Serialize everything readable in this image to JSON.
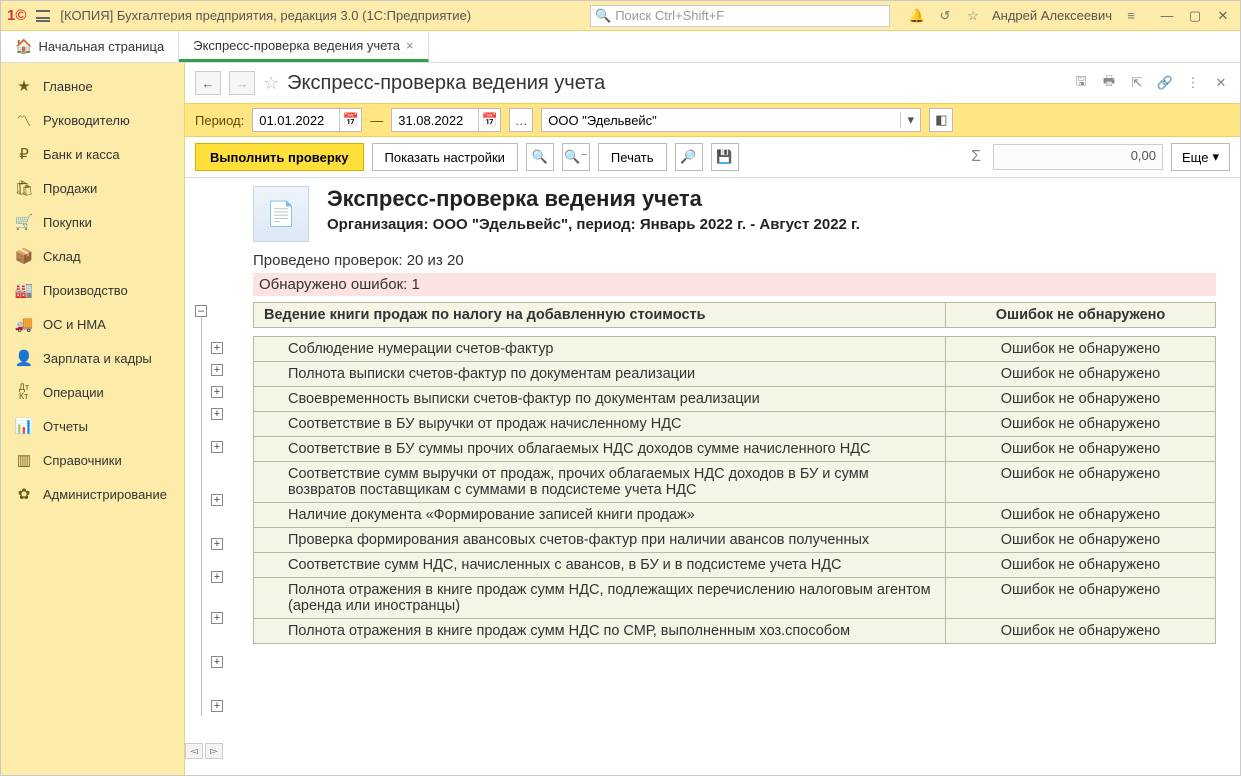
{
  "titlebar": {
    "app_title": "[КОПИЯ] Бухгалтерия предприятия, редакция 3.0  (1С:Предприятие)",
    "search_placeholder": "Поиск Ctrl+Shift+F",
    "user": "Андрей Алексеевич"
  },
  "tabs": {
    "home": "Начальная страница",
    "active": "Экспресс-проверка ведения учета"
  },
  "sidebar": {
    "items": [
      {
        "icon": "★",
        "label": "Главное"
      },
      {
        "icon": "📈",
        "label": "Руководителю"
      },
      {
        "icon": "₽",
        "label": "Банк и касса"
      },
      {
        "icon": "🛍",
        "label": "Продажи"
      },
      {
        "icon": "🛒",
        "label": "Покупки"
      },
      {
        "icon": "📦",
        "label": "Склад"
      },
      {
        "icon": "🏭",
        "label": "Производство"
      },
      {
        "icon": "🚚",
        "label": "ОС и НМА"
      },
      {
        "icon": "👤",
        "label": "Зарплата и кадры"
      },
      {
        "icon": "Дт",
        "label": "Операции"
      },
      {
        "icon": "📊",
        "label": "Отчеты"
      },
      {
        "icon": "📚",
        "label": "Справочники"
      },
      {
        "icon": "✿",
        "label": "Администрирование"
      }
    ]
  },
  "page": {
    "title": "Экспресс-проверка ведения учета",
    "period_label": "Период:",
    "date_from": "01.01.2022",
    "date_to": "31.08.2022",
    "org": "ООО \"Эдельвейс\"",
    "btn_run": "Выполнить проверку",
    "btn_settings": "Показать настройки",
    "btn_print": "Печать",
    "sum_value": "0,00",
    "btn_more": "Еще"
  },
  "report": {
    "title": "Экспресс-проверка ведения учета",
    "subtitle": "Организация: ООО \"Эдельвейс\", период: Январь 2022 г. - Август 2022 г.",
    "checks_done": "Проведено проверок: 20 из 20",
    "errors_found": "Обнаружено ошибок: 1",
    "group_title": "Ведение книги продаж по налогу на добавленную стоимость",
    "group_status": "Ошибок не обнаружено",
    "ok": "Ошибок не обнаружено",
    "rows": [
      "Соблюдение нумерации счетов-фактур",
      "Полнота выписки счетов-фактур по документам реализации",
      "Своевременность выписки счетов-фактур по документам реализации",
      "Соответствие в БУ выручки от продаж начисленному НДС",
      "Соответствие в БУ суммы прочих облагаемых НДС доходов сумме начисленного НДС",
      "Соответствие сумм выручки от продаж, прочих облагаемых НДС доходов в БУ и сумм возвратов поставщикам с суммами в подсистеме учета НДС",
      "Наличие документа «Формирование записей книги продаж»",
      "Проверка формирования авансовых счетов-фактур при наличии авансов полученных",
      "Соответствие сумм НДС, начисленных с авансов, в БУ и в подсистеме учета НДС",
      "Полнота отражения в книге продаж сумм НДС, подлежащих перечислению налоговым агентом (аренда или иностранцы)",
      "Полнота отражения в книге продаж сумм НДС по СМР, выполненным хоз.способом"
    ]
  }
}
